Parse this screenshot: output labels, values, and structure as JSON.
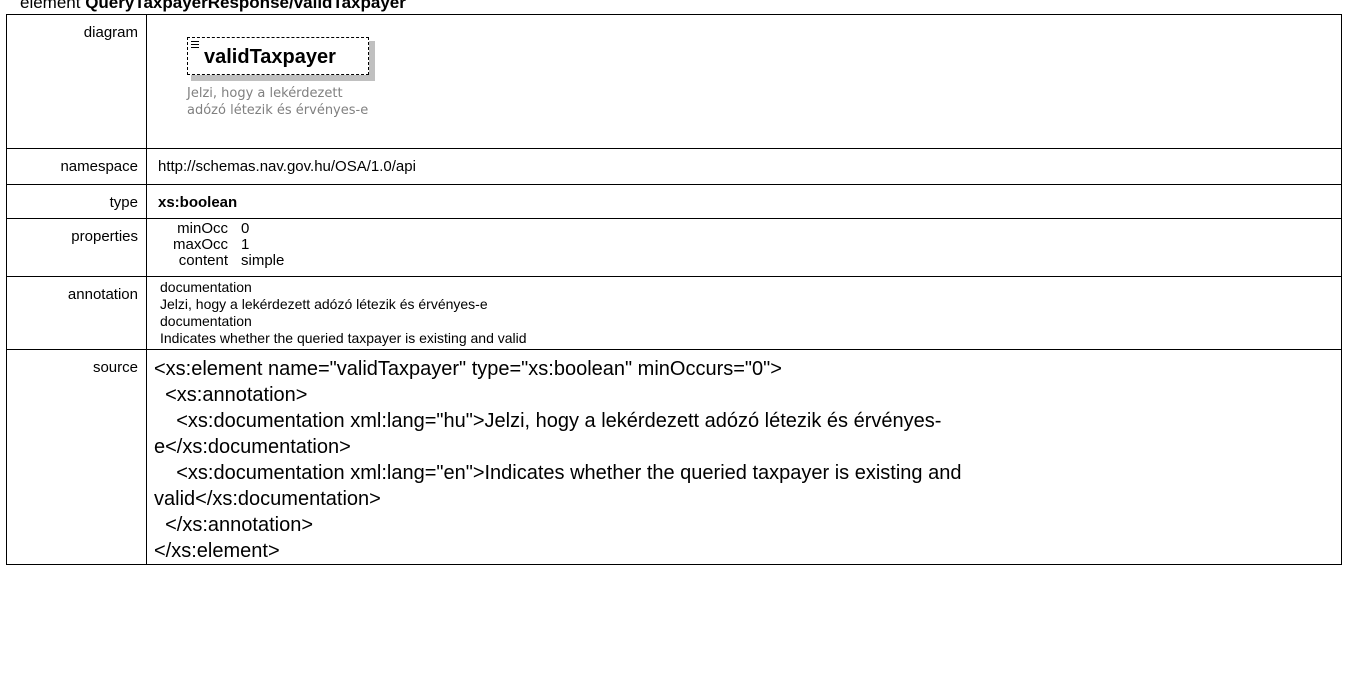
{
  "heading": {
    "prefix": "element ",
    "name": "QueryTaxpayerResponse/validTaxpayer"
  },
  "rows": {
    "diagram": {
      "label": "diagram",
      "element_name": "validTaxpayer",
      "note_line1": "Jelzi, hogy a lekérdezett",
      "note_line2": "adózó létezik és érvényes-e"
    },
    "namespace": {
      "label": "namespace",
      "value": "http://schemas.nav.gov.hu/OSA/1.0/api"
    },
    "type": {
      "label": "type",
      "value": "xs:boolean"
    },
    "properties": {
      "label": "properties",
      "items": [
        {
          "key": "minOcc",
          "value": "0"
        },
        {
          "key": "maxOcc",
          "value": "1"
        },
        {
          "key": "content",
          "value": "simple"
        }
      ]
    },
    "annotation": {
      "label": "annotation",
      "lines": [
        "documentation",
        "Jelzi, hogy a lekérdezett adózó létezik és érvényes-e",
        "documentation",
        "Indicates whether the queried taxpayer is existing and valid"
      ]
    },
    "source": {
      "label": "source",
      "lines": [
        "<xs:element name=\"validTaxpayer\" type=\"xs:boolean\" minOccurs=\"0\">",
        "  <xs:annotation>",
        "    <xs:documentation xml:lang=\"hu\">Jelzi, hogy a lekérdezett adózó létezik és érvényes-",
        "e</xs:documentation>",
        "    <xs:documentation xml:lang=\"en\">Indicates whether the queried taxpayer is existing and",
        "valid</xs:documentation>",
        "  </xs:annotation>",
        "</xs:element>"
      ]
    }
  }
}
